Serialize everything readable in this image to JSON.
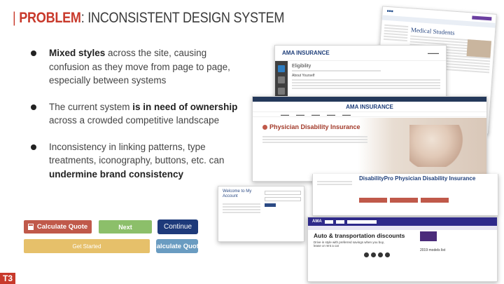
{
  "title": {
    "bar": "| ",
    "highlight": "PROBLEM",
    "rest": ": INCONSISTENT DESIGN SYSTEM"
  },
  "bullets": [
    {
      "pre": "",
      "bold": "Mixed styles",
      "post": " across the site, causing confusion as they move from page to page, especially between systems"
    },
    {
      "pre": "The current system ",
      "bold": "is in need of ownership",
      "post": " across a crowded competitive landscape"
    },
    {
      "pre": "Inconsistency in linking patterns, type treatments, iconography, buttons, etc. can ",
      "bold": "undermine brand consistency",
      "post": ""
    }
  ],
  "buttons": {
    "calculate_quote_1": "Calculate Quote",
    "next": "Next",
    "continue": "Continue",
    "get_started": "Get Started",
    "calculate_quote_2": "Calculate Quote"
  },
  "logo": "T3",
  "screens": {
    "medical": {
      "heading": "Medical Students"
    },
    "eligibility": {
      "brand": "AMA INSURANCE",
      "heading": "Eligibility",
      "sub": "About Yourself"
    },
    "physician": {
      "brand": "AMA INSURANCE",
      "heading": "Physician Disability Insurance"
    },
    "physician_detail": {
      "heading": "DisabilityPro Physician Disability Insurance"
    },
    "account": {
      "heading": "Welcome to My Account"
    },
    "auto": {
      "brand": "AMA",
      "heading": "Auto & transportation discounts",
      "sub": "Drive in style with preferred savings when you buy, lease or rent a car",
      "list_title": "2019 models list"
    }
  }
}
